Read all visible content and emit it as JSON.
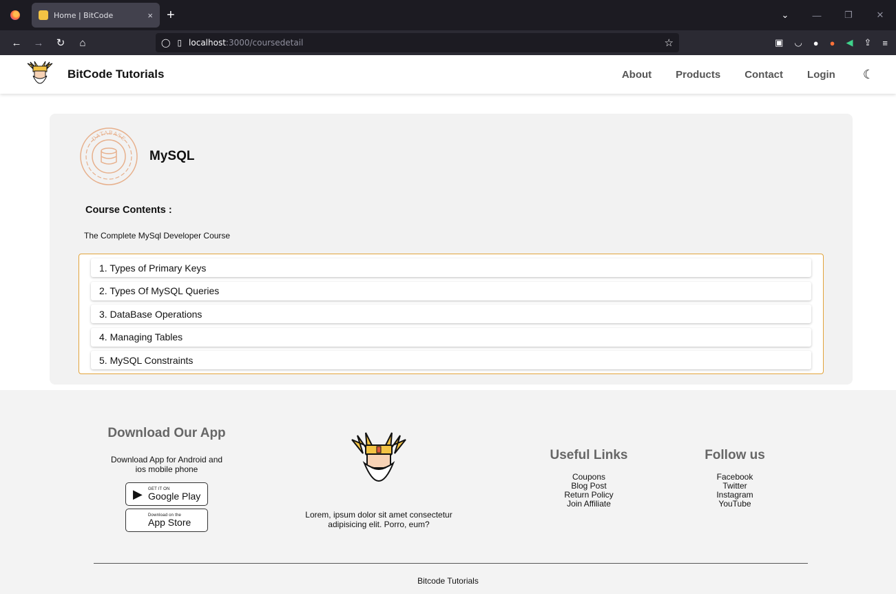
{
  "browser": {
    "tab_title": "Home | BitCode",
    "tab_close": "×",
    "new_tab": "+",
    "url_host": "localhost",
    "url_path": ":3000/coursedetail"
  },
  "header": {
    "brand": "BitCode Tutorials",
    "nav": [
      "About",
      "Products",
      "Contact",
      "Login"
    ],
    "theme_icon": "moon-icon"
  },
  "course": {
    "badge_text": "DATABASE",
    "name": "MySQL",
    "section_title": "Course Contents :",
    "subtitle": "The Complete MySql Developer Course",
    "items": [
      "1. Types of Primary Keys",
      "2. Types Of MySQL Queries",
      "3. DataBase Operations",
      "4. Managing Tables",
      "5. MySQL Constraints"
    ]
  },
  "footer": {
    "app": {
      "title": "Download Our App",
      "desc": "Download App for Android and ios mobile phone",
      "google_small": "GET IT ON",
      "google_big": "Google Play",
      "apple_small": "Download on the",
      "apple_big": "App Store"
    },
    "about_text": "Lorem, ipsum dolor sit amet consectetur adipisicing elit. Porro, eum?",
    "links": {
      "title": "Useful Links",
      "items": [
        "Coupons",
        "Blog Post",
        "Return Policy",
        "Join Affiliate"
      ]
    },
    "follow": {
      "title": "Follow us",
      "items": [
        "Facebook",
        "Twitter",
        "Instagram",
        "YouTube"
      ]
    },
    "copyright": "Bitcode Tutorials"
  },
  "colors": {
    "accent": "#e2a33a",
    "card_bg": "#f2f2f2",
    "footer_bg": "#f3f3f3",
    "badge": "#e7b08c"
  }
}
